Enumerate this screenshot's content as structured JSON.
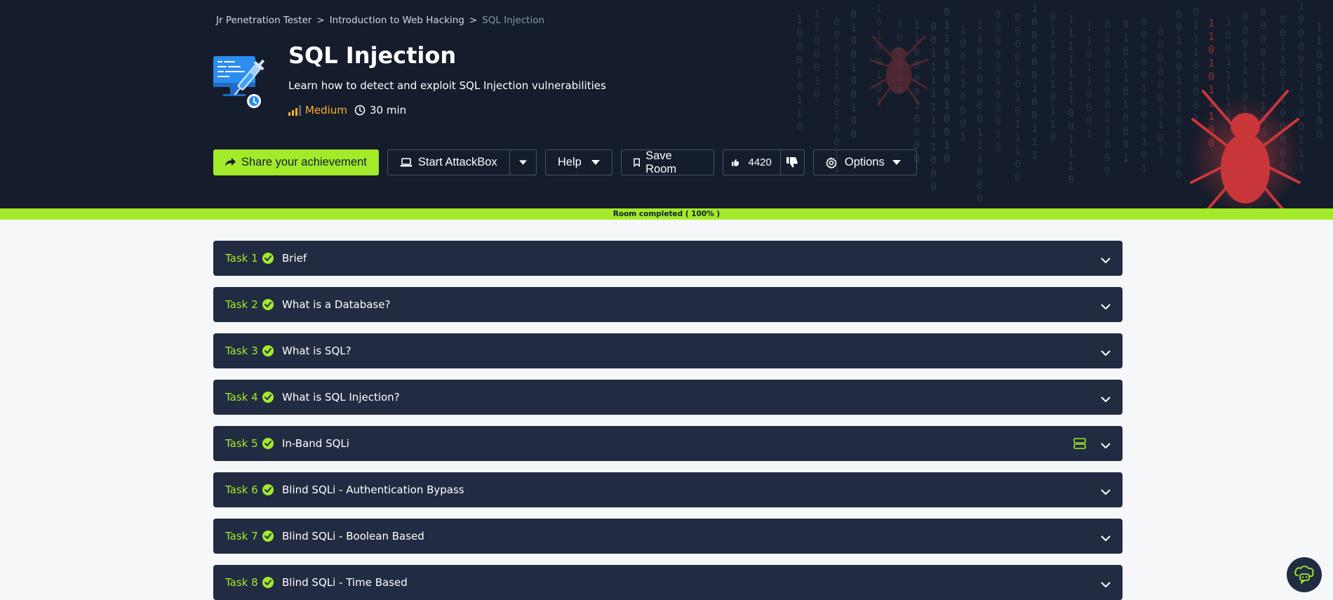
{
  "breadcrumb": {
    "items": [
      "Jr Penetration Tester",
      "Introduction to Web Hacking",
      "SQL Injection"
    ],
    "separator": ">"
  },
  "room": {
    "title": "SQL Injection",
    "subtitle": "Learn how to detect and exploit SQL Injection vulnerabilities",
    "difficulty": "Medium",
    "duration": "30 min",
    "icon": "monitor-syringe-icon"
  },
  "actions": {
    "share_label": "Share your achievement",
    "attackbox_label": "Start AttackBox",
    "help_label": "Help",
    "save_label": "Save Room",
    "likes": "4420",
    "options_label": "Options"
  },
  "progress": {
    "label": "Room completed ( 100% )",
    "percent": 100
  },
  "tasks": [
    {
      "number": "Task 1",
      "title": "Brief",
      "completed": true
    },
    {
      "number": "Task 2",
      "title": "What is a Database?",
      "completed": true
    },
    {
      "number": "Task 3",
      "title": "What is SQL?",
      "completed": true
    },
    {
      "number": "Task 4",
      "title": "What is SQL Injection?",
      "completed": true
    },
    {
      "number": "Task 5",
      "title": "In-Band SQLi",
      "completed": true,
      "has_machine": true
    },
    {
      "number": "Task 6",
      "title": "Blind SQLi - Authentication Bypass",
      "completed": true
    },
    {
      "number": "Task 7",
      "title": "Blind SQLi - Boolean Based",
      "completed": true
    },
    {
      "number": "Task 8",
      "title": "Blind SQLi - Time Based",
      "completed": true
    }
  ],
  "colors": {
    "hero_bg": "#151c2b",
    "accent": "#a3ea2a",
    "task_bg": "#212c42",
    "difficulty": "#ffb12b",
    "spider": "#c0392b"
  }
}
